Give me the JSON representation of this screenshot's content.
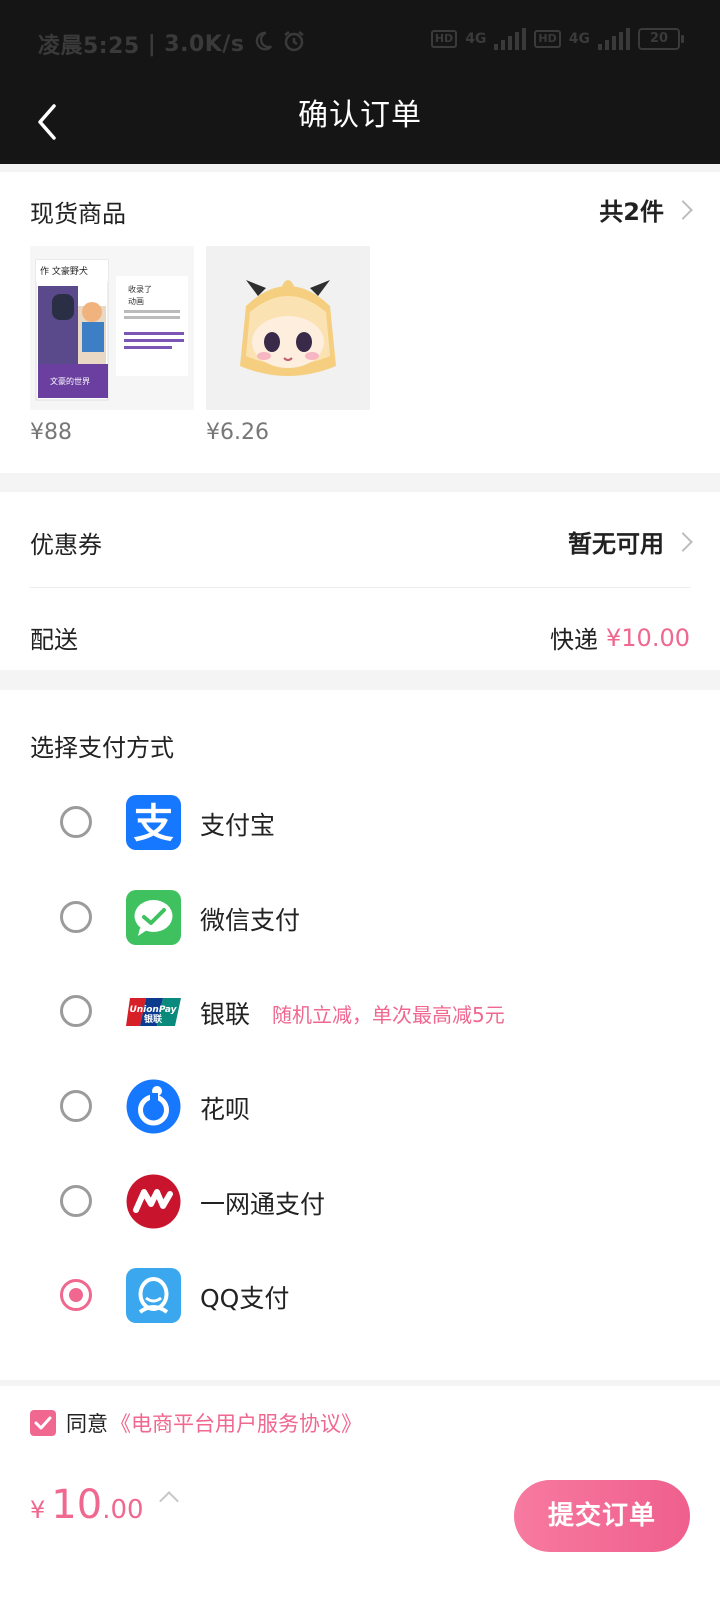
{
  "status_bar": {
    "time": "凌晨5:25",
    "speed": "3.0K/s",
    "net1": "4G",
    "net2": "4G",
    "hd": "HD",
    "battery": "20"
  },
  "header": {
    "title": "确认订单"
  },
  "goods": {
    "section_title": "现货商品",
    "count_label": "共2件",
    "items": [
      {
        "price": "¥88"
      },
      {
        "price": "¥6.26"
      }
    ]
  },
  "coupon": {
    "label": "优惠券",
    "value": "暂无可用"
  },
  "delivery": {
    "label": "配送",
    "method": "快递",
    "price": "¥10.00"
  },
  "payment": {
    "title": "选择支付方式",
    "methods": [
      {
        "name": "支付宝",
        "icon": "alipay-icon",
        "selected": false
      },
      {
        "name": "微信支付",
        "icon": "wechat-pay-icon",
        "selected": false
      },
      {
        "name": "银联",
        "icon": "unionpay-icon",
        "tip": "随机立减，单次最高减5元",
        "selected": false
      },
      {
        "name": "花呗",
        "icon": "huabei-icon",
        "selected": false
      },
      {
        "name": "一网通支付",
        "icon": "yiwangtong-icon",
        "selected": false
      },
      {
        "name": "QQ支付",
        "icon": "qq-pay-icon",
        "selected": true
      }
    ]
  },
  "agreement": {
    "prefix": "同意",
    "link": "《电商平台用户服务协议》",
    "checked": true
  },
  "footer": {
    "currency": "¥",
    "total_int": "10",
    "total_dec": ".00",
    "submit_label": "提交订单"
  },
  "colors": {
    "accent": "#f0678f",
    "header_bg": "#151515",
    "alipay": "#1677ff",
    "wechat": "#3fc15f",
    "unionpay_red": "#d71f27",
    "qq_blue": "#3aa7ee"
  }
}
